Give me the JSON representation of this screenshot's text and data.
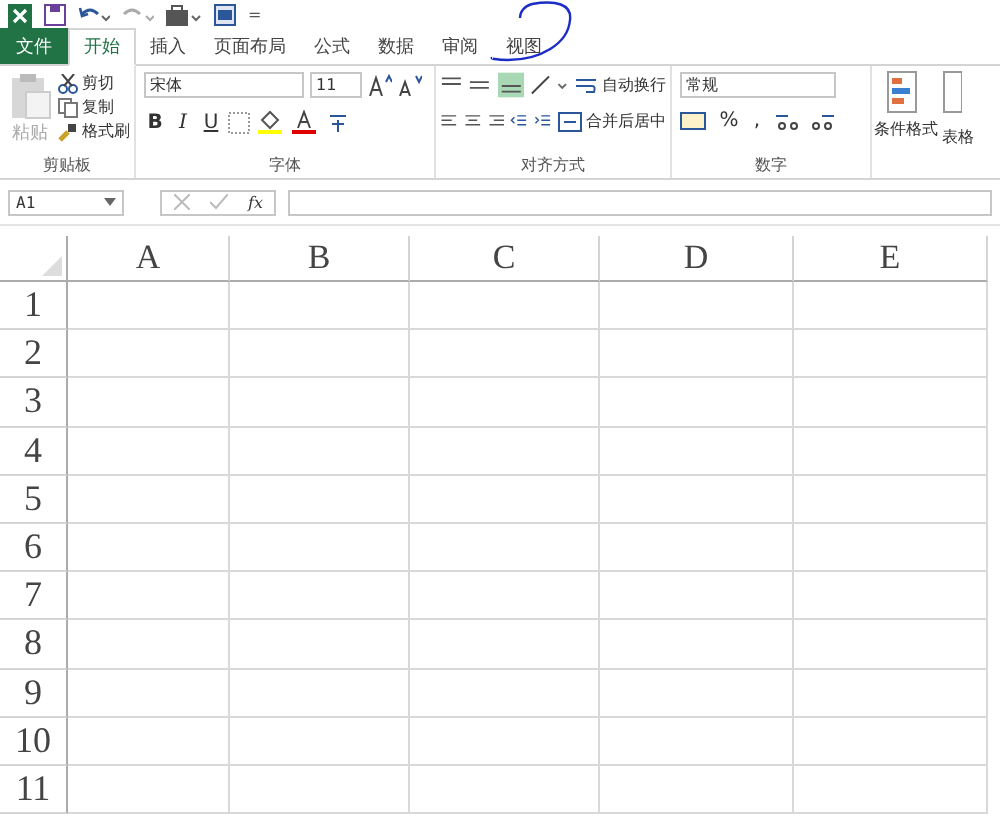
{
  "quick_access": {
    "customize": "="
  },
  "tabs": [
    {
      "label": "文件",
      "kind": "file",
      "selected": false
    },
    {
      "label": "开始",
      "kind": "tab",
      "selected": true
    },
    {
      "label": "插入",
      "kind": "tab",
      "selected": false
    },
    {
      "label": "页面布局",
      "kind": "tab",
      "selected": false
    },
    {
      "label": "公式",
      "kind": "tab",
      "selected": false
    },
    {
      "label": "数据",
      "kind": "tab",
      "selected": false
    },
    {
      "label": "审阅",
      "kind": "tab",
      "selected": false
    },
    {
      "label": "视图",
      "kind": "tab",
      "selected": false
    }
  ],
  "clipboard": {
    "paste": "粘贴",
    "cut": "剪切",
    "copy": "复制",
    "format_painter": "格式刷",
    "group": "剪贴板"
  },
  "font": {
    "name": "宋体",
    "size": "11",
    "bold": "B",
    "italic": "I",
    "underline": "U",
    "group": "字体"
  },
  "alignment": {
    "wrap": "自动换行",
    "merge": "合并后居中",
    "group": "对齐方式"
  },
  "number": {
    "format": "常规",
    "percent": "%",
    "comma": ",",
    "group": "数字"
  },
  "styles": {
    "conditional": "条件格式",
    "table_partial": "表格"
  },
  "formula_bar": {
    "name_box": "A1",
    "fx": "fx"
  },
  "columns": [
    "A",
    "B",
    "C",
    "D",
    "E"
  ],
  "rows": [
    "1",
    "2",
    "3",
    "4",
    "5",
    "6",
    "7",
    "8",
    "9",
    "10",
    "11"
  ]
}
